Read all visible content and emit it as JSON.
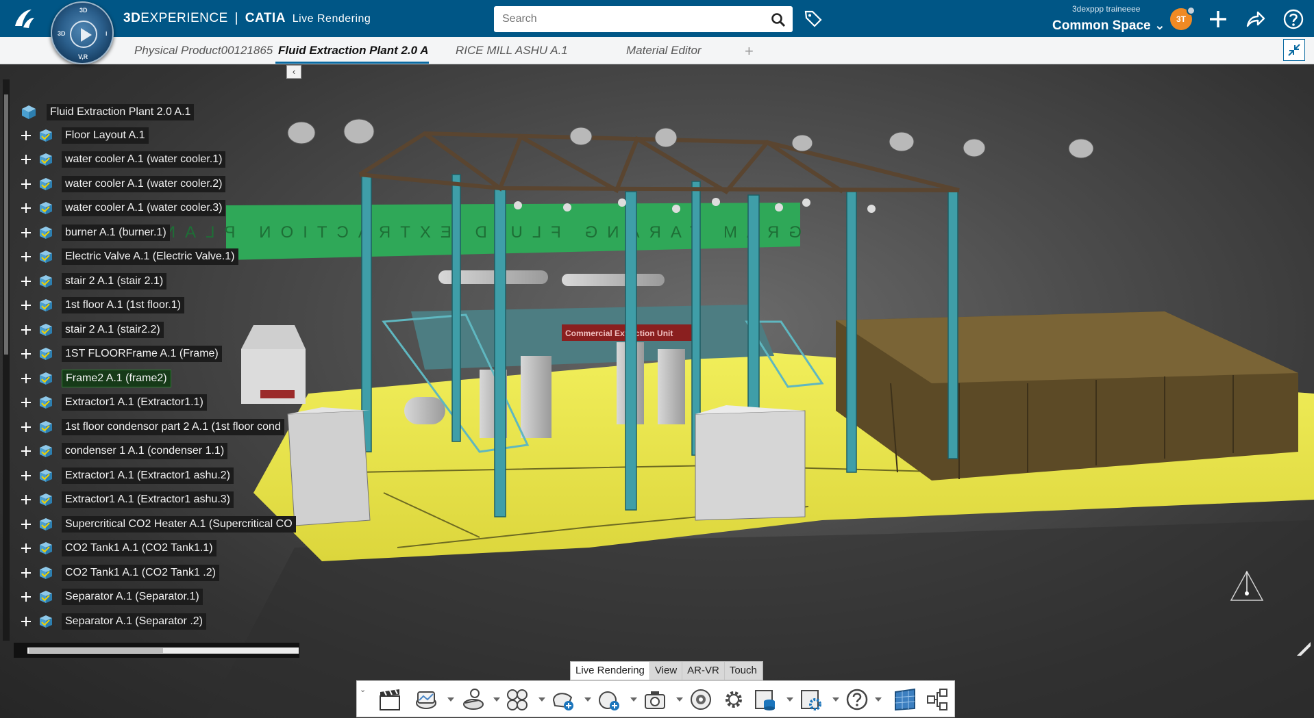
{
  "header": {
    "brand_prefix": "3D",
    "brand_main": "EXPERIENCE",
    "brand_separator": "|",
    "brand_app": "CATIA",
    "brand_sub": "Live Rendering",
    "compass_labels": {
      "top": "3D",
      "left": "3D",
      "right": "i",
      "bottom": "V,R"
    },
    "search_placeholder": "Search",
    "user_name": "3dexppp traineeee",
    "space_label": "Common Space",
    "avatar_initials": "3T",
    "accent_color": "#005686"
  },
  "tabs": [
    {
      "label": "Physical Product00121865",
      "active": false
    },
    {
      "label": "Fluid Extraction Plant 2.0 A.1",
      "active": true
    },
    {
      "label": "RICE MILL ASHU A.1",
      "active": false
    },
    {
      "label": "Material Editor",
      "active": false
    }
  ],
  "tab_add_label": "+",
  "tree": {
    "collapse_label": "‹",
    "root": "Fluid Extraction Plant 2.0 A.1",
    "items": [
      {
        "label": "Floor Layout A.1"
      },
      {
        "label": "water cooler A.1 (water cooler.1)"
      },
      {
        "label": "water cooler A.1 (water cooler.2)"
      },
      {
        "label": "water cooler A.1 (water cooler.3)"
      },
      {
        "label": "burner A.1 (burner.1)"
      },
      {
        "label": "Electric Valve A.1 (Electric Valve.1)"
      },
      {
        "label": "stair 2 A.1 (stair 2.1)"
      },
      {
        "label": "1st floor A.1 (1st floor.1)"
      },
      {
        "label": "stair 2 A.1 (stair2.2)"
      },
      {
        "label": "1ST FLOORFrame A.1 (Frame)"
      },
      {
        "label": "Frame2 A.1 (frame2)",
        "highlight": true
      },
      {
        "label": "Extractor1 A.1 (Extractor1.1)"
      },
      {
        "label": "1st floor condensor part 2 A.1 (1st floor cond"
      },
      {
        "label": "condenser 1 A.1 (condenser 1.1)"
      },
      {
        "label": "Extractor1 A.1 (Extractor1 ashu.2)"
      },
      {
        "label": "Extractor1 A.1 (Extractor1 ashu.3)"
      },
      {
        "label": "Supercritical CO2 Heater A.1 (Supercritical CO"
      },
      {
        "label": "CO2 Tank1 A.1 (CO2 Tank1.1)"
      },
      {
        "label": "CO2 Tank1 A.1 (CO2 Tank1 .2)"
      },
      {
        "label": "Separator A.1 (Separator.1)"
      },
      {
        "label": "Separator A.1 (Separator .2)"
      }
    ]
  },
  "scene": {
    "banner_text": "GRAM TARANG FLUID EXTRACTION PLANT",
    "unit_sign": "Commercial Extraction Unit",
    "floor_color": "#e8e44a",
    "frame_color": "#3f9ea8",
    "truss_color": "#5a4530"
  },
  "action_bar": {
    "tabs": [
      {
        "label": "Live Rendering",
        "active": true
      },
      {
        "label": "View",
        "active": false
      },
      {
        "label": "AR-VR",
        "active": false
      },
      {
        "label": "Touch",
        "active": false
      }
    ],
    "buttons": [
      "clapperboard-icon",
      "environment-icon",
      "lighting-icon",
      "materials-icon",
      "shape-icon",
      "stage-icon",
      "camera-icon",
      "render-icon",
      "settings-icon",
      "database-icon",
      "options-icon",
      "help-icon",
      "texture-icon",
      "structure-icon"
    ]
  }
}
